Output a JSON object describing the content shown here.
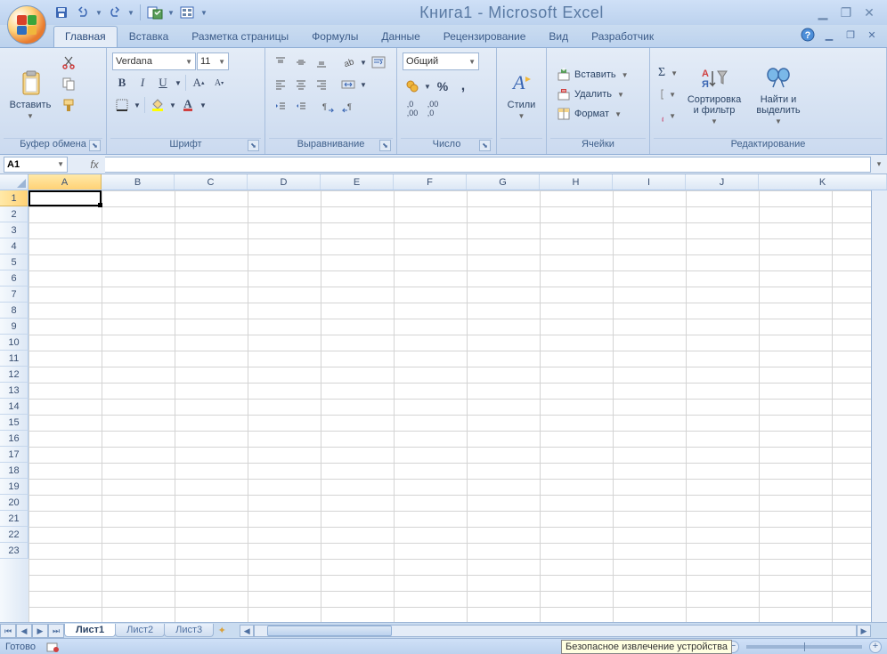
{
  "title": "Книга1 - Microsoft Excel",
  "tabs": {
    "items": [
      "Главная",
      "Вставка",
      "Разметка страницы",
      "Формулы",
      "Данные",
      "Рецензирование",
      "Вид",
      "Разработчик"
    ],
    "active": 0
  },
  "ribbon": {
    "clipboard": {
      "label": "Буфер обмена",
      "paste": "Вставить"
    },
    "font": {
      "label": "Шрифт",
      "name": "Verdana",
      "size": "11"
    },
    "alignment": {
      "label": "Выравнивание"
    },
    "number": {
      "label": "Число",
      "format": "Общий"
    },
    "styles": {
      "label": "",
      "btn": "Стили"
    },
    "cells": {
      "label": "Ячейки",
      "insert": "Вставить",
      "delete": "Удалить",
      "format": "Формат"
    },
    "editing": {
      "label": "Редактирование",
      "sort": "Сортировка и фильтр",
      "find": "Найти и выделить"
    }
  },
  "namebox": "A1",
  "columns": [
    "A",
    "B",
    "C",
    "D",
    "E",
    "F",
    "G",
    "H",
    "I",
    "J",
    "K"
  ],
  "rows": 23,
  "active_cell": "A1",
  "sheets": {
    "items": [
      "Лист1",
      "Лист2",
      "Лист3"
    ],
    "active": 0
  },
  "status": "Готово",
  "tooltip": "Безопасное извлечение устройства"
}
